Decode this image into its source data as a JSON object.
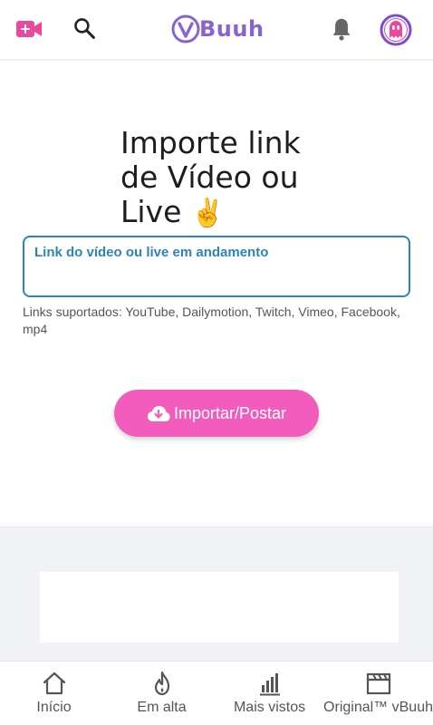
{
  "header": {
    "logo_text": "Buuh",
    "icons": [
      "video-add-icon",
      "search-icon",
      "notification-bell-icon",
      "profile-avatar-icon"
    ],
    "accent": "#e8489e"
  },
  "main": {
    "headline_lines": [
      "Importe link",
      "de Vídeo ou",
      "Live"
    ],
    "headline_emoji": "✌️",
    "link_placeholder": "Link do vídeo ou live em andamento",
    "supported_text": "Links suportados: YouTube, Dailymotion, Twitch, Vimeo, Facebook, mp4",
    "import_button_label": "Importar/Postar",
    "import_button_color": "#f25cbc",
    "field_border_color": "#2a86b9"
  },
  "bottom_nav": {
    "items": [
      {
        "label": "Início",
        "icon": "home-icon"
      },
      {
        "label": "Em alta",
        "icon": "flame-icon"
      },
      {
        "label": "Mais vistos",
        "icon": "bar-chart-icon"
      },
      {
        "label": "Original™ vBuuh",
        "icon": "clapperboard-icon"
      }
    ]
  }
}
